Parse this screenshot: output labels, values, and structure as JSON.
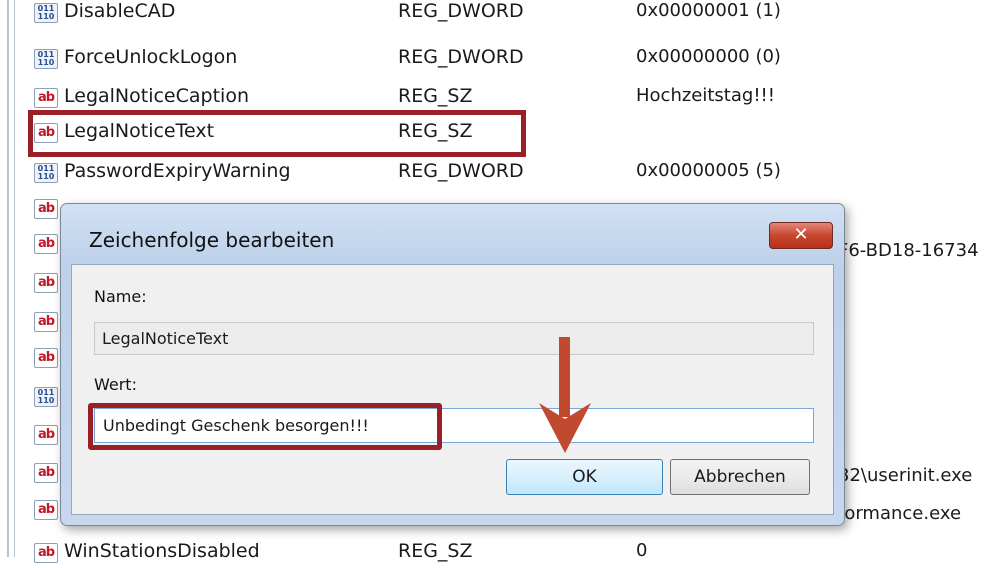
{
  "registry": {
    "rows": [
      {
        "name": "DisableCAD",
        "type": "REG_DWORD",
        "data": "0x00000001 (1)",
        "icon": "dword-icon"
      },
      {
        "name": "ForceUnlockLogon",
        "type": "REG_DWORD",
        "data": "0x00000000 (0)",
        "icon": "dword-icon"
      },
      {
        "name": "LegalNoticeCaption",
        "type": "REG_SZ",
        "data": "Hochzeitstag!!!",
        "icon": "string-icon"
      },
      {
        "name": "LegalNoticeText",
        "type": "REG_SZ",
        "data": "",
        "icon": "string-icon"
      },
      {
        "name": "PasswordExpiryWarning",
        "type": "REG_DWORD",
        "data": "0x00000005 (5)",
        "icon": "dword-icon"
      },
      {
        "name": "WinStationsDisabled",
        "type": "REG_SZ",
        "data": "0",
        "icon": "string-icon"
      }
    ],
    "partial_data": [
      "F6-BD18-16734",
      "32\\userinit.exe",
      "formance.exe"
    ],
    "icon_glyphs": {
      "string": "ab",
      "dword": "011\n110"
    }
  },
  "dialog": {
    "title": "Zeichenfolge bearbeiten",
    "close_label": "✕",
    "name_label": "Name:",
    "name_value": "LegalNoticeText",
    "value_label": "Wert:",
    "value_text": "Unbedingt Geschenk besorgen!!!",
    "ok_label": "OK",
    "cancel_label": "Abbrechen"
  },
  "colors": {
    "highlight": "#9b1f26",
    "arrow": "#c0492f"
  }
}
